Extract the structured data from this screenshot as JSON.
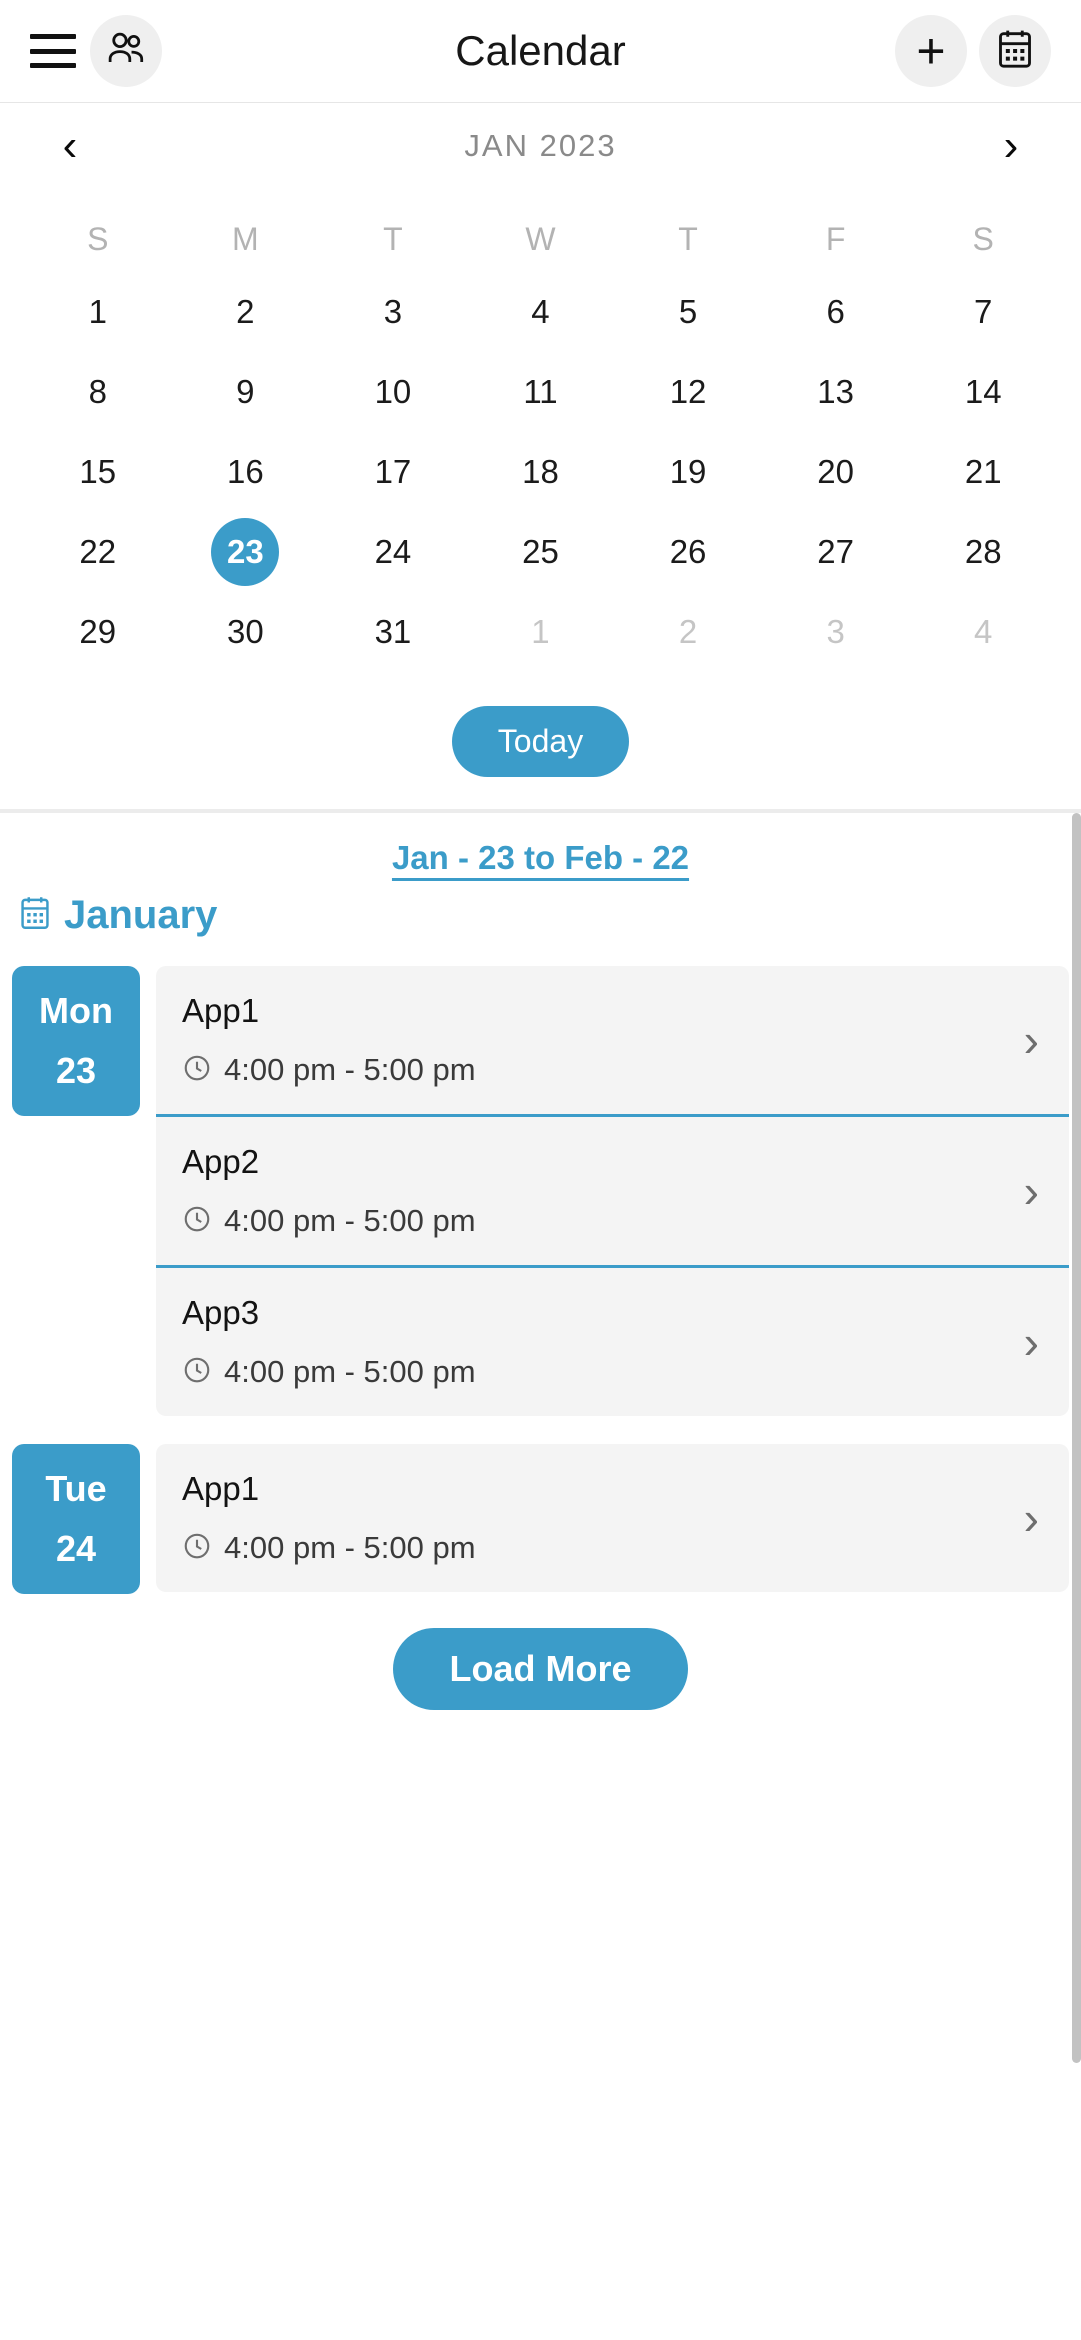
{
  "header": {
    "title": "Calendar",
    "menu_icon": "hamburger-menu-icon",
    "people_icon": "people-icon",
    "add_label": "+",
    "calendar_icon": "calendar-icon"
  },
  "month_nav": {
    "prev_label": "‹",
    "next_label": "›",
    "label": "JAN 2023"
  },
  "calendar": {
    "weekdays": [
      "S",
      "M",
      "T",
      "W",
      "T",
      "F",
      "S"
    ],
    "weeks": [
      [
        {
          "day": "1",
          "muted": false,
          "selected": false
        },
        {
          "day": "2",
          "muted": false,
          "selected": false
        },
        {
          "day": "3",
          "muted": false,
          "selected": false
        },
        {
          "day": "4",
          "muted": false,
          "selected": false
        },
        {
          "day": "5",
          "muted": false,
          "selected": false
        },
        {
          "day": "6",
          "muted": false,
          "selected": false
        },
        {
          "day": "7",
          "muted": false,
          "selected": false
        }
      ],
      [
        {
          "day": "8",
          "muted": false,
          "selected": false
        },
        {
          "day": "9",
          "muted": false,
          "selected": false
        },
        {
          "day": "10",
          "muted": false,
          "selected": false
        },
        {
          "day": "11",
          "muted": false,
          "selected": false
        },
        {
          "day": "12",
          "muted": false,
          "selected": false
        },
        {
          "day": "13",
          "muted": false,
          "selected": false
        },
        {
          "day": "14",
          "muted": false,
          "selected": false
        }
      ],
      [
        {
          "day": "15",
          "muted": false,
          "selected": false
        },
        {
          "day": "16",
          "muted": false,
          "selected": false
        },
        {
          "day": "17",
          "muted": false,
          "selected": false
        },
        {
          "day": "18",
          "muted": false,
          "selected": false
        },
        {
          "day": "19",
          "muted": false,
          "selected": false
        },
        {
          "day": "20",
          "muted": false,
          "selected": false
        },
        {
          "day": "21",
          "muted": false,
          "selected": false
        }
      ],
      [
        {
          "day": "22",
          "muted": false,
          "selected": false
        },
        {
          "day": "23",
          "muted": false,
          "selected": true
        },
        {
          "day": "24",
          "muted": false,
          "selected": false
        },
        {
          "day": "25",
          "muted": false,
          "selected": false
        },
        {
          "day": "26",
          "muted": false,
          "selected": false
        },
        {
          "day": "27",
          "muted": false,
          "selected": false
        },
        {
          "day": "28",
          "muted": false,
          "selected": false
        }
      ],
      [
        {
          "day": "29",
          "muted": false,
          "selected": false
        },
        {
          "day": "30",
          "muted": false,
          "selected": false
        },
        {
          "day": "31",
          "muted": false,
          "selected": false
        },
        {
          "day": "1",
          "muted": true,
          "selected": false
        },
        {
          "day": "2",
          "muted": true,
          "selected": false
        },
        {
          "day": "3",
          "muted": true,
          "selected": false
        },
        {
          "day": "4",
          "muted": true,
          "selected": false
        }
      ]
    ],
    "today_label": "Today"
  },
  "agenda": {
    "range_label": "Jan - 23 to Feb - 22",
    "month_label": "January",
    "month_icon": "calendar-icon",
    "groups": [
      {
        "dow": "Mon",
        "day": "23",
        "appointments": [
          {
            "title": "App1",
            "time": "4:00 pm - 5:00 pm",
            "clock_icon": "clock-icon",
            "chevron": "›"
          },
          {
            "title": "App2",
            "time": "4:00 pm - 5:00 pm",
            "clock_icon": "clock-icon",
            "chevron": "›"
          },
          {
            "title": "App3",
            "time": "4:00 pm - 5:00 pm",
            "clock_icon": "clock-icon",
            "chevron": "›"
          }
        ]
      },
      {
        "dow": "Tue",
        "day": "24",
        "appointments": [
          {
            "title": "App1",
            "time": "4:00 pm - 5:00 pm",
            "clock_icon": "clock-icon",
            "chevron": "›"
          }
        ]
      }
    ],
    "load_more_label": "Load More"
  },
  "colors": {
    "accent": "#3b9cc9",
    "card_bg": "#f4f4f4",
    "muted_text": "#c5c5c5",
    "header_icon_bg": "#efefef"
  }
}
